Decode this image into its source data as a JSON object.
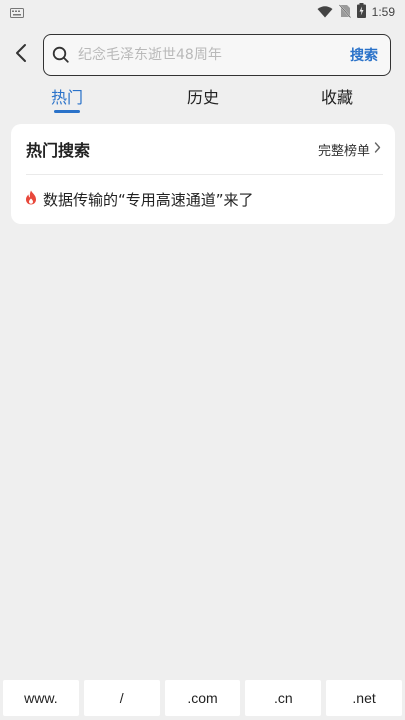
{
  "status_bar": {
    "time": "1:59",
    "icons": [
      "keyboard-icon",
      "wifi-icon",
      "no-sim-icon",
      "battery-charging-icon"
    ]
  },
  "search": {
    "placeholder": "纪念毛泽东逝世48周年",
    "button_label": "搜索"
  },
  "tabs": [
    {
      "label": "热门",
      "active": true
    },
    {
      "label": "历史",
      "active": false
    },
    {
      "label": "收藏",
      "active": false
    }
  ],
  "hot_search": {
    "title": "热门搜索",
    "full_list_label": "完整榜单",
    "items": [
      {
        "text": "数据传输的“专用高速通道”来了",
        "icon": "fire-icon"
      }
    ]
  },
  "shortcuts": [
    "www.",
    "/",
    ".com",
    ".cn",
    ".net"
  ],
  "colors": {
    "accent": "#2a72c9",
    "fire": "#e8483b",
    "background": "#efefef"
  }
}
